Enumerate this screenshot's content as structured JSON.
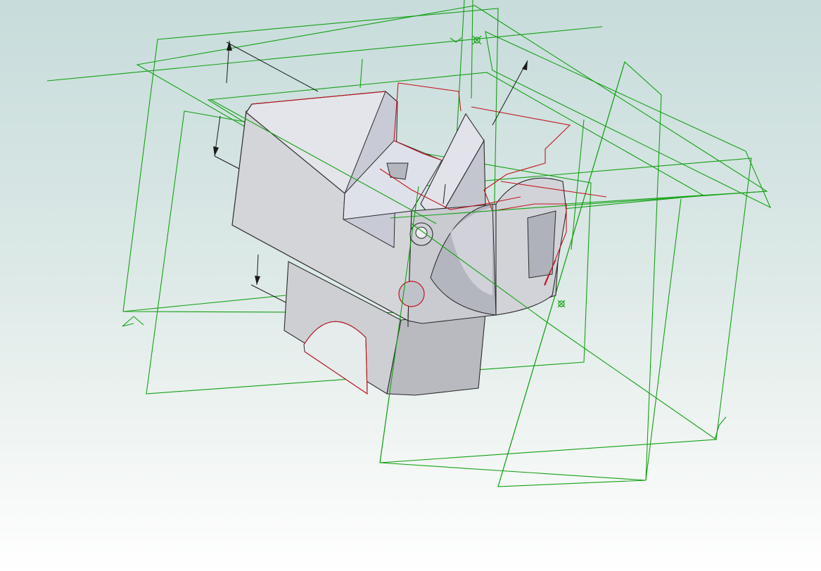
{
  "view": {
    "kind": "3d-cad-viewport",
    "background_top": "#c7dcdb",
    "background_bottom": "#ffffff",
    "model_color": "#d6d7db",
    "reference_plane_color": "#14a014",
    "sketch_edge_color": "#c0161e",
    "dimension_color": "#1a1a1a"
  },
  "icons": {
    "origin_marker": "origin-icon",
    "point_marker": "point-icon",
    "plane_axis_triad": "triad-icon"
  }
}
